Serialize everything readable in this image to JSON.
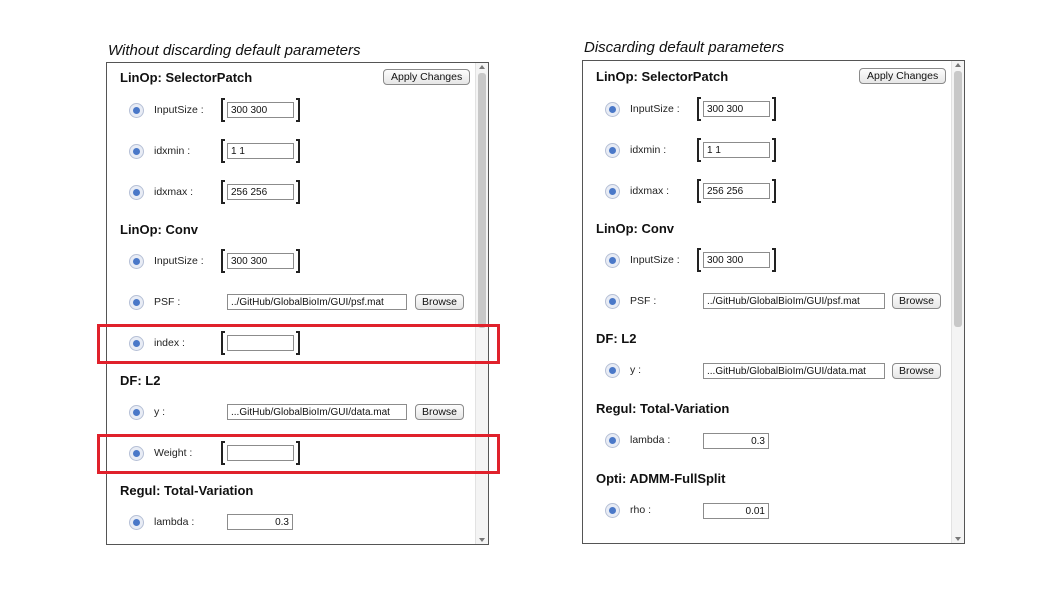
{
  "left": {
    "caption": "Without discarding default parameters",
    "apply_label": "Apply Changes",
    "sections": [
      {
        "title": "LinOp: SelectorPatch"
      },
      {
        "title": "LinOp: Conv"
      },
      {
        "title": "DF: L2"
      },
      {
        "title": "Regul: Total-Variation"
      }
    ],
    "params": [
      {
        "label": "InputSize :",
        "value": "300 300"
      },
      {
        "label": "idxmin :",
        "value": "1 1"
      },
      {
        "label": "idxmax :",
        "value": "256 256"
      },
      {
        "label": "InputSize :",
        "value": "300 300"
      },
      {
        "label": "PSF :",
        "value": "../GitHub/GlobalBioIm/GUI/psf.mat",
        "browse": "Browse"
      },
      {
        "label": "index :",
        "value": ""
      },
      {
        "label": "y :",
        "value": "...GitHub/GlobalBioIm/GUI/data.mat",
        "browse": "Browse"
      },
      {
        "label": "Weight :",
        "value": ""
      },
      {
        "label": "lambda :",
        "value": "0.3"
      }
    ]
  },
  "right": {
    "caption": "Discarding default parameters",
    "apply_label": "Apply Changes",
    "sections": [
      {
        "title": "LinOp: SelectorPatch"
      },
      {
        "title": "LinOp: Conv"
      },
      {
        "title": "DF: L2"
      },
      {
        "title": "Regul: Total-Variation"
      },
      {
        "title": "Opti: ADMM-FullSplit"
      }
    ],
    "params": [
      {
        "label": "InputSize :",
        "value": "300 300"
      },
      {
        "label": "idxmin :",
        "value": "1 1"
      },
      {
        "label": "idxmax :",
        "value": "256 256"
      },
      {
        "label": "InputSize :",
        "value": "300 300"
      },
      {
        "label": "PSF :",
        "value": "../GitHub/GlobalBioIm/GUI/psf.mat",
        "browse": "Browse"
      },
      {
        "label": "y :",
        "value": "...GitHub/GlobalBioIm/GUI/data.mat",
        "browse": "Browse"
      },
      {
        "label": "lambda :",
        "value": "0.3"
      },
      {
        "label": "rho :",
        "value": "0.01"
      }
    ]
  },
  "colors": {
    "highlight": "#e0212b",
    "info_icon": "#4a78c8"
  }
}
